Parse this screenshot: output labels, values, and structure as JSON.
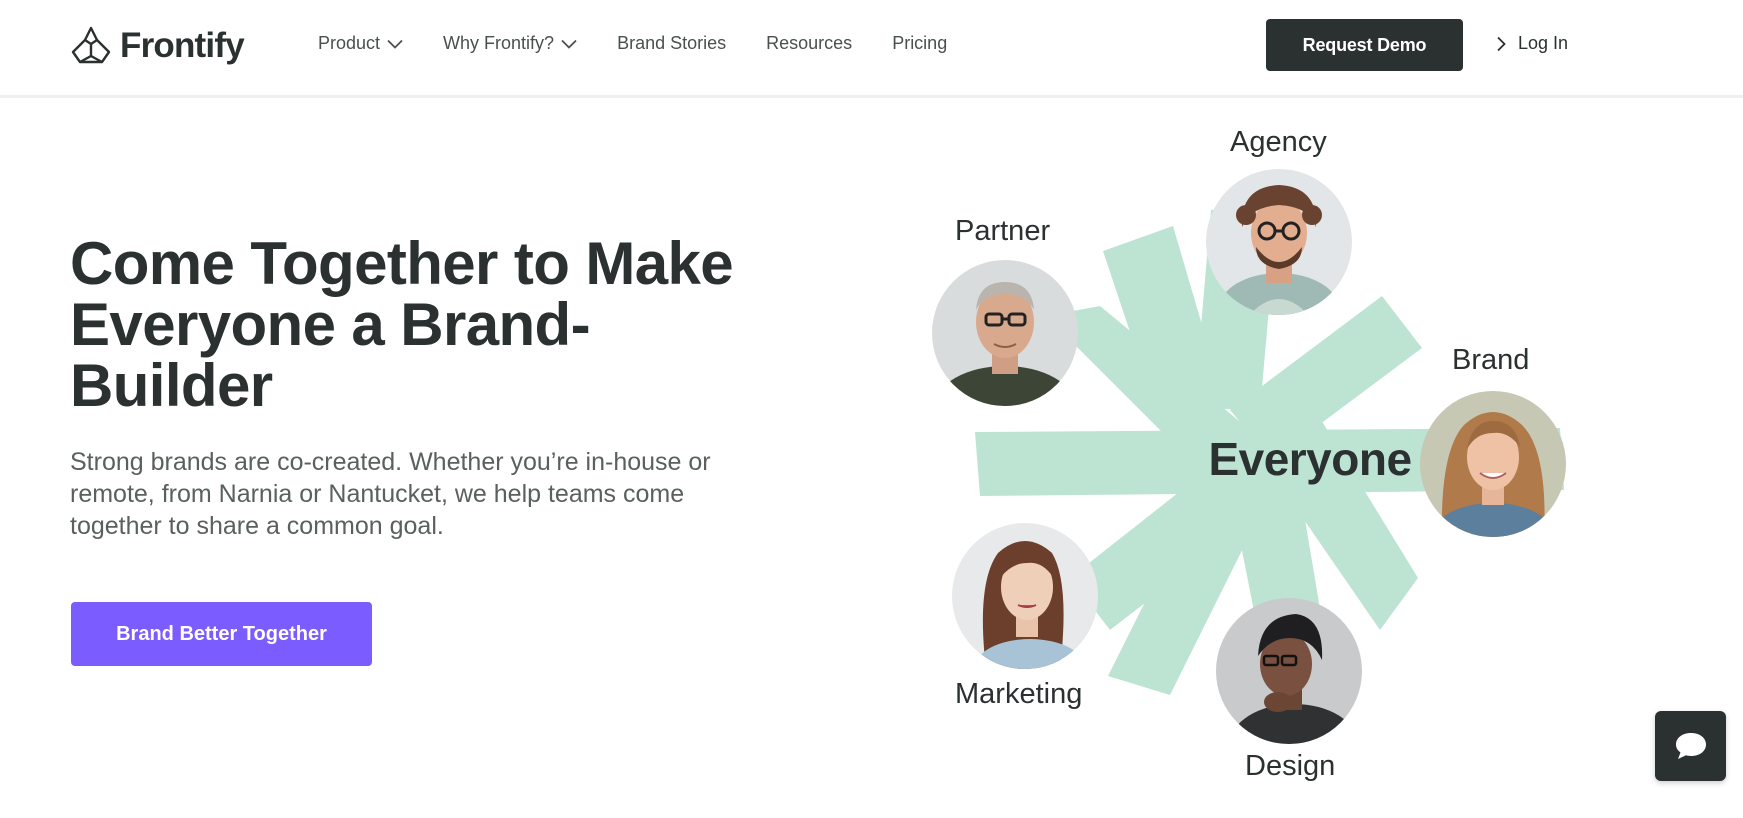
{
  "header": {
    "logo_text": "Frontify",
    "logo_icon": "frontify-logo-icon",
    "nav": [
      {
        "label": "Product",
        "has_dropdown": true
      },
      {
        "label": "Why Frontify?",
        "has_dropdown": true
      },
      {
        "label": "Brand Stories",
        "has_dropdown": false
      },
      {
        "label": "Resources",
        "has_dropdown": false
      },
      {
        "label": "Pricing",
        "has_dropdown": false
      }
    ],
    "request_demo_label": "Request Demo",
    "login_label": "Log In"
  },
  "hero": {
    "headline": "Come Together to Make Everyone a Brand-Builder",
    "subtext": "Strong brands are co-created. Whether you’re in-house or remote, from Narnia or Nantucket, we help teams come together to share a common goal.",
    "cta_label": "Brand Better Together"
  },
  "illustration": {
    "center_label": "Everyone",
    "personas": [
      {
        "label": "Agency",
        "avatar": "avatar-curly-hair-glasses"
      },
      {
        "label": "Partner",
        "avatar": "avatar-older-man-glasses"
      },
      {
        "label": "Brand",
        "avatar": "avatar-smiling-woman"
      },
      {
        "label": "Marketing",
        "avatar": "avatar-young-woman"
      },
      {
        "label": "Design",
        "avatar": "avatar-man-beanie"
      }
    ]
  },
  "chat": {
    "icon": "chat-bubble-icon"
  },
  "colors": {
    "text_dark": "#2b3030",
    "accent_purple": "#7b5cff",
    "starburst_green": "#bde3d3",
    "demo_button": "#2b3030"
  }
}
